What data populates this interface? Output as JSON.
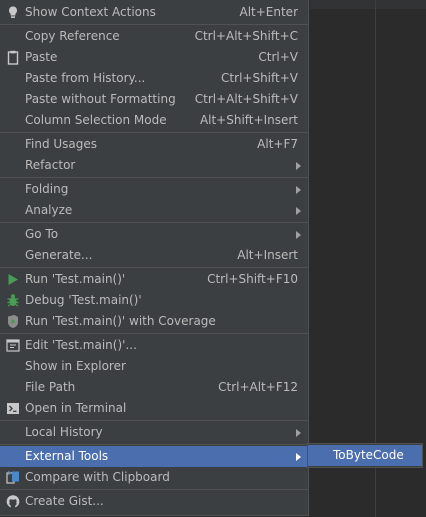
{
  "menu": {
    "items": [
      {
        "label": "Show Context Actions",
        "shortcut": "Alt+Enter",
        "icon": "lightbulb-icon"
      },
      {
        "label": "Copy Reference",
        "shortcut": "Ctrl+Alt+Shift+C"
      },
      {
        "label": "Paste",
        "shortcut": "Ctrl+V",
        "icon": "clipboard-icon"
      },
      {
        "label": "Paste from History...",
        "shortcut": "Ctrl+Shift+V"
      },
      {
        "label": "Paste without Formatting",
        "shortcut": "Ctrl+Alt+Shift+V"
      },
      {
        "label": "Column Selection Mode",
        "shortcut": "Alt+Shift+Insert"
      },
      {
        "label": "Find Usages",
        "shortcut": "Alt+F7"
      },
      {
        "label": "Refactor",
        "submenu": true
      },
      {
        "label": "Folding",
        "submenu": true
      },
      {
        "label": "Analyze",
        "submenu": true
      },
      {
        "label": "Go To",
        "submenu": true
      },
      {
        "label": "Generate...",
        "shortcut": "Alt+Insert"
      },
      {
        "label": "Run 'Test.main()'",
        "shortcut": "Ctrl+Shift+F10",
        "icon": "run-icon"
      },
      {
        "label": "Debug 'Test.main()'",
        "icon": "debug-icon"
      },
      {
        "label": "Run 'Test.main()' with Coverage",
        "icon": "coverage-icon"
      },
      {
        "label": "Edit 'Test.main()'...",
        "icon": "edit-config-icon"
      },
      {
        "label": "Show in Explorer"
      },
      {
        "label": "File Path",
        "shortcut": "Ctrl+Alt+F12"
      },
      {
        "label": "Open in Terminal",
        "icon": "terminal-icon"
      },
      {
        "label": "Local History",
        "submenu": true
      },
      {
        "label": "External Tools",
        "submenu": true,
        "selected": true
      },
      {
        "label": "Compare with Clipboard",
        "icon": "compare-icon"
      },
      {
        "label": "Create Gist...",
        "icon": "github-icon"
      }
    ]
  },
  "submenu": {
    "items": [
      {
        "label": "ToByteCode"
      }
    ]
  },
  "colors": {
    "menu_bg": "#3c3f41",
    "text": "#bbbbbb",
    "selection": "#4b6eaf",
    "editor_bg": "#2b2b2b"
  }
}
